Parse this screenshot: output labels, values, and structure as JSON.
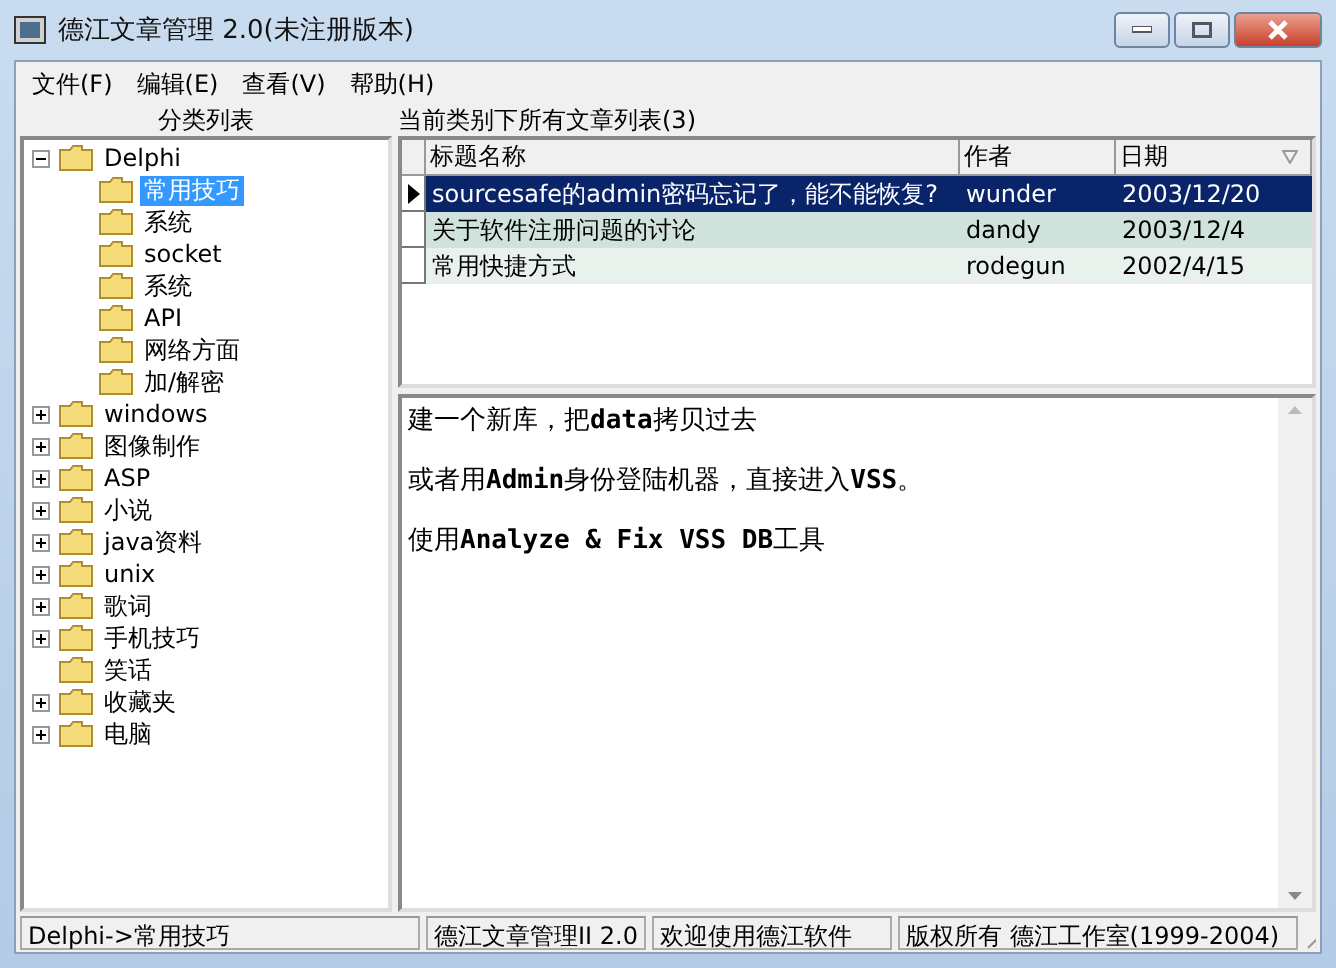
{
  "window": {
    "title": "德江文章管理 2.0(未注册版本)"
  },
  "menu": [
    "文件(F)",
    "编辑(E)",
    "查看(V)",
    "帮助(H)"
  ],
  "tree": {
    "title": "分类列表",
    "items": [
      {
        "label": "Delphi",
        "expanded": true,
        "selected": false,
        "children": [
          {
            "label": "常用技巧",
            "selected": true
          },
          {
            "label": "系统",
            "selected": false
          },
          {
            "label": "socket",
            "selected": false
          },
          {
            "label": "系统",
            "selected": false
          },
          {
            "label": "API",
            "selected": false
          },
          {
            "label": "网络方面",
            "selected": false
          },
          {
            "label": "加/解密",
            "selected": false
          }
        ]
      },
      {
        "label": "windows",
        "expanded": false,
        "selected": false
      },
      {
        "label": "图像制作",
        "expanded": false,
        "selected": false
      },
      {
        "label": "ASP",
        "expanded": false,
        "selected": false
      },
      {
        "label": "小说",
        "expanded": false,
        "selected": false
      },
      {
        "label": "java资料",
        "expanded": false,
        "selected": false
      },
      {
        "label": "unix",
        "expanded": false,
        "selected": false
      },
      {
        "label": "歌词",
        "expanded": false,
        "selected": false
      },
      {
        "label": "手机技巧",
        "expanded": false,
        "selected": false
      },
      {
        "label": "笑话",
        "selected": false
      },
      {
        "label": "收藏夹",
        "expanded": false,
        "selected": false
      },
      {
        "label": "电脑",
        "expanded": false,
        "selected": false
      }
    ]
  },
  "articles": {
    "title": "当前类别下所有文章列表(3)",
    "columns": [
      "标题名称",
      "作者",
      "日期"
    ],
    "rows": [
      {
        "title": "sourcesafe的admin密码忘记了，能不能恢复?",
        "author": "wunder",
        "date": "2003/12/20",
        "selected": true
      },
      {
        "title": "关于软件注册问题的讨论",
        "author": "dandy",
        "date": "2003/12/4",
        "selected": false
      },
      {
        "title": "常用快捷方式",
        "author": "rodegun",
        "date": "2002/4/15",
        "selected": false
      }
    ]
  },
  "content": [
    "建一个新库，把**data**拷贝过去",
    "或者用**Admin**身份登陆机器，直接进入**VSS**。",
    "使用**Analyze & Fix VSS DB**工具"
  ],
  "status_bar": [
    "Delphi->常用技巧",
    "德江文章管理II 2.0",
    "欢迎使用德江软件",
    "版权所有 德江工作室(1999-2004)"
  ]
}
